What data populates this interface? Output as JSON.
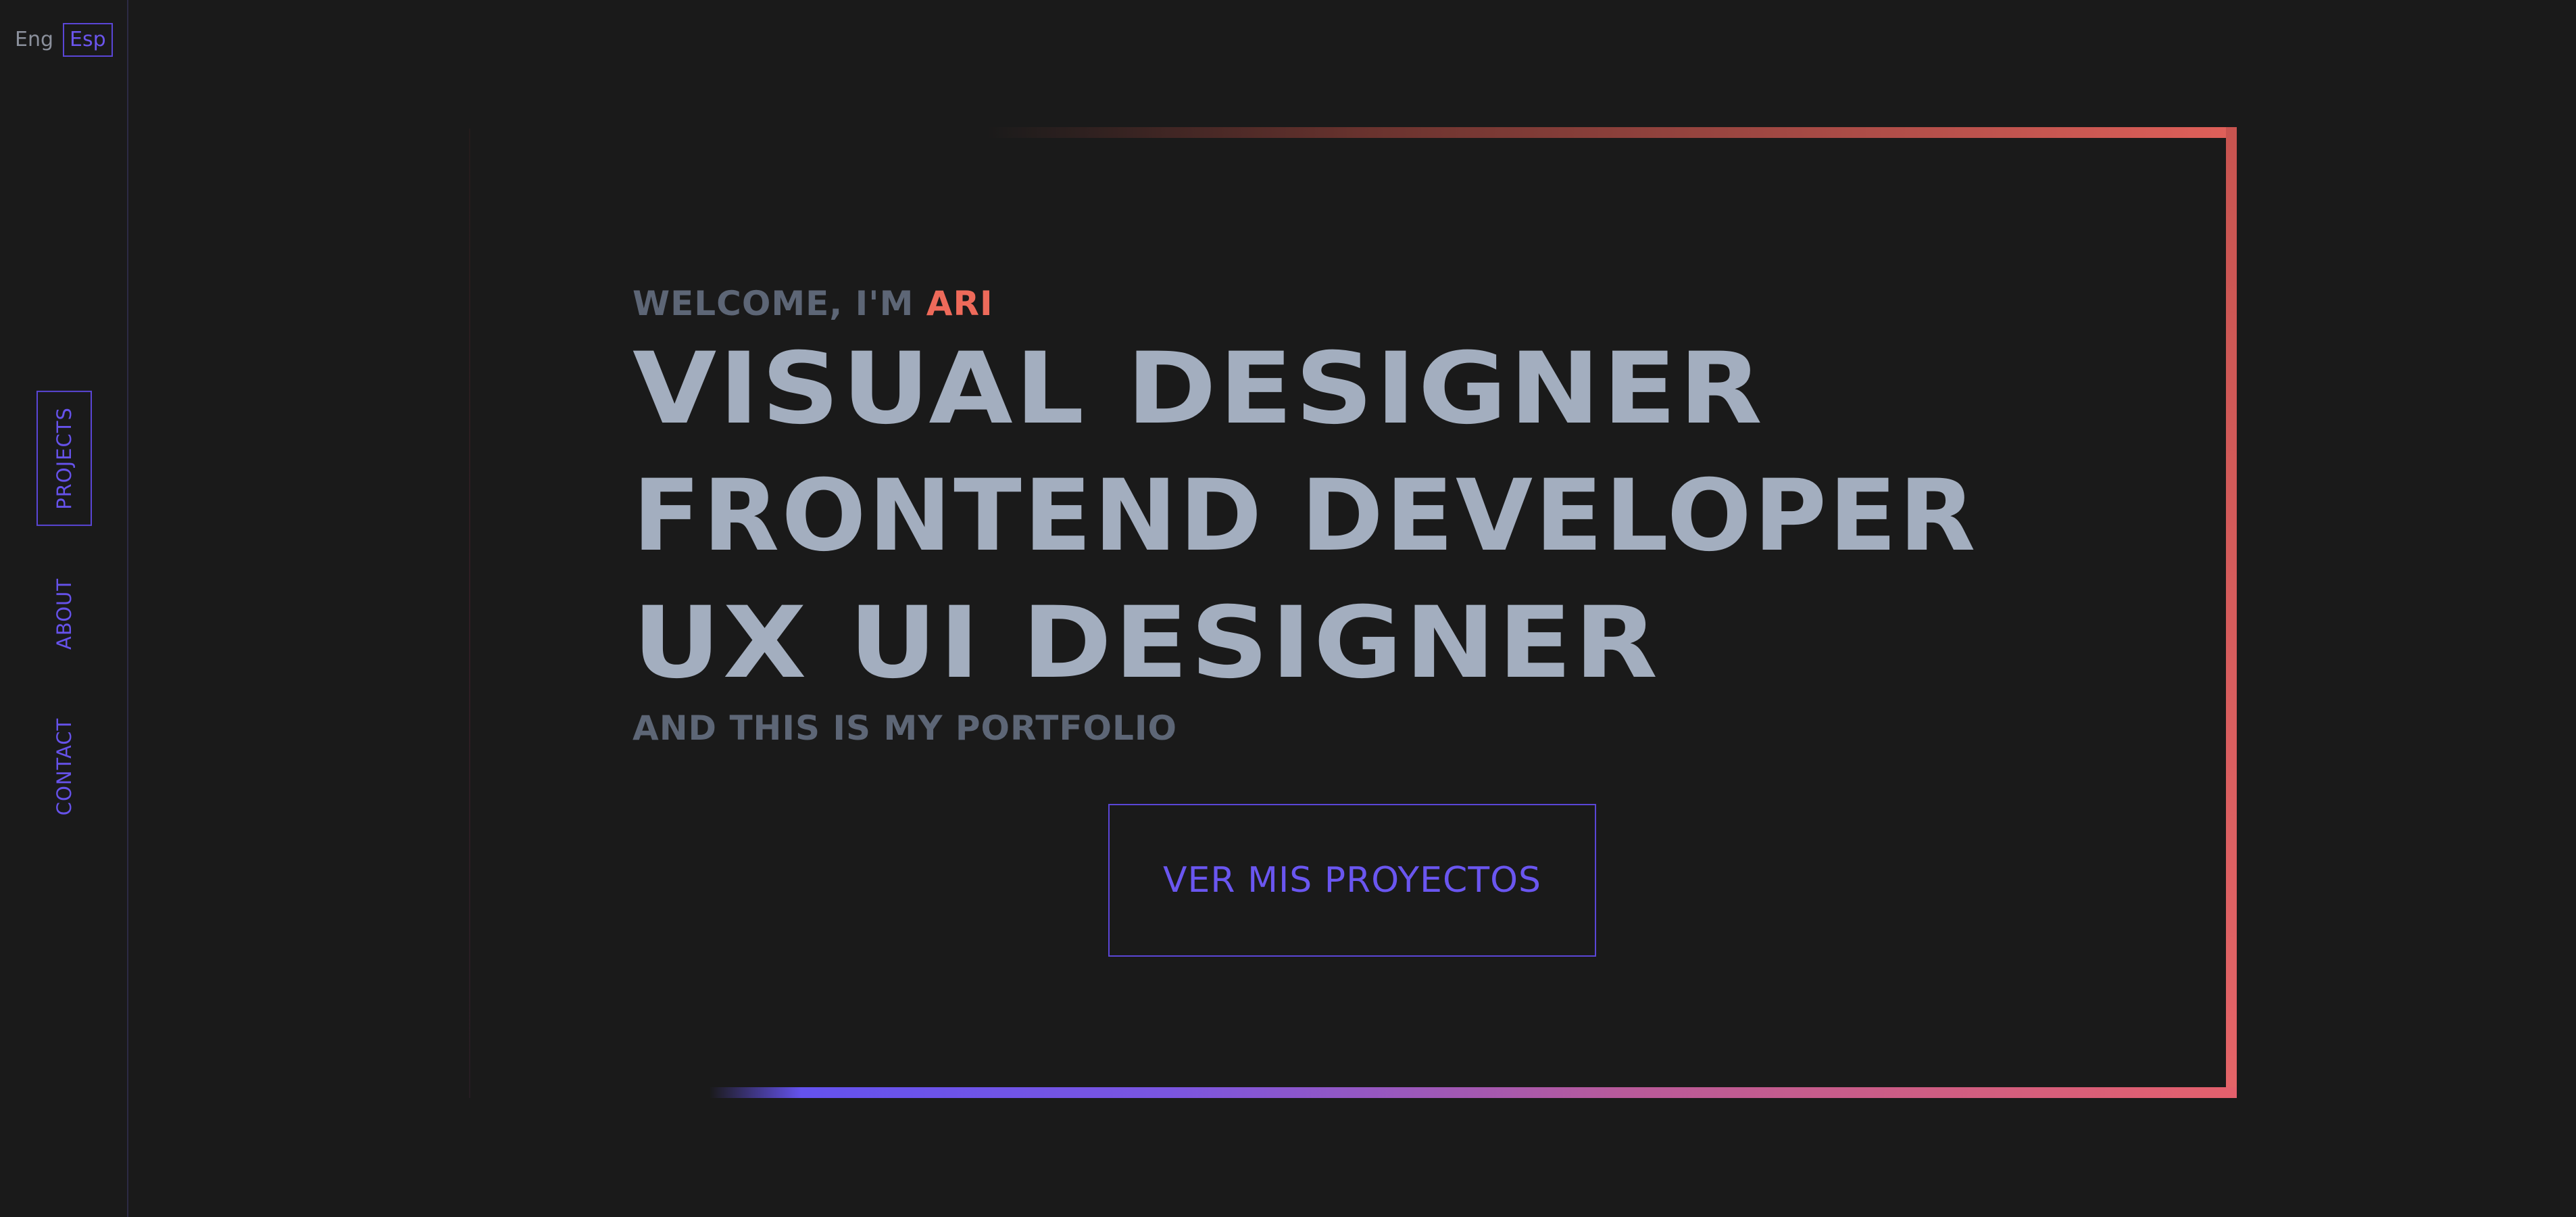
{
  "language_switch": {
    "english_label": "Eng",
    "spanish_label": "Esp",
    "active": "Esp"
  },
  "sidebar": {
    "items": [
      {
        "label": "PROJECTS",
        "active": true
      },
      {
        "label": "ABOUT",
        "active": false
      },
      {
        "label": "CONTACT",
        "active": false
      }
    ]
  },
  "hero": {
    "welcome_prefix": "WELCOME, I'M",
    "welcome_name": "ARI",
    "roles": [
      "VISUAL DESIGNER",
      "FRONTEND DEVELOPER",
      "UX UI DESIGNER"
    ],
    "tagline": "AND THIS IS MY PORTFOLIO"
  },
  "cta": {
    "label": "VER MIS PROYECTOS"
  },
  "colors": {
    "background": "#1a1a1a",
    "accent_purple": "#6652ea",
    "accent_coral": "#ee6a5a",
    "heading_text": "#a3aebf",
    "muted_text": "#5d6676"
  }
}
